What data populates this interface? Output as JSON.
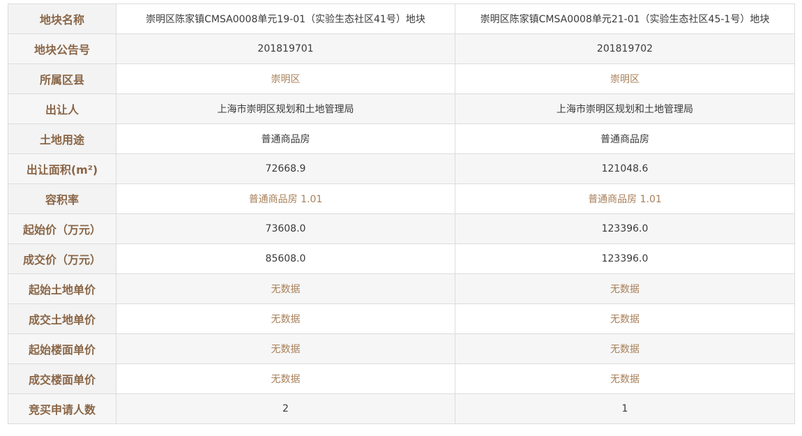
{
  "rows": [
    {
      "label": "地块名称",
      "v1": "崇明区陈家镇CMSA0008单元19-01（实验生态社区41号）地块",
      "v2": "崇明区陈家镇CMSA0008单元21-01（实验生态社区45-1号）地块",
      "style": "normal"
    },
    {
      "label": "地块公告号",
      "v1": "201819701",
      "v2": "201819702",
      "style": "normal"
    },
    {
      "label": "所属区县",
      "v1": "崇明区",
      "v2": "崇明区",
      "style": "brown"
    },
    {
      "label": "出让人",
      "v1": "上海市崇明区规划和土地管理局",
      "v2": "上海市崇明区规划和土地管理局",
      "style": "normal"
    },
    {
      "label": "土地用途",
      "v1": "普通商品房",
      "v2": "普通商品房",
      "style": "normal"
    },
    {
      "label": "出让面积(m²)",
      "v1": "72668.9",
      "v2": "121048.6",
      "style": "normal"
    },
    {
      "label": "容积率",
      "v1": "普通商品房 1.01",
      "v2": "普通商品房 1.01",
      "style": "brown"
    },
    {
      "label": "起始价（万元）",
      "v1": "73608.0",
      "v2": "123396.0",
      "style": "normal"
    },
    {
      "label": "成交价（万元）",
      "v1": "85608.0",
      "v2": "123396.0",
      "style": "normal"
    },
    {
      "label": "起始土地单价",
      "v1": "无数据",
      "v2": "无数据",
      "style": "brown"
    },
    {
      "label": "成交土地单价",
      "v1": "无数据",
      "v2": "无数据",
      "style": "brown"
    },
    {
      "label": "起始楼面单价",
      "v1": "无数据",
      "v2": "无数据",
      "style": "brown"
    },
    {
      "label": "成交楼面单价",
      "v1": "无数据",
      "v2": "无数据",
      "style": "brown"
    },
    {
      "label": "竞买申请人数",
      "v1": "2",
      "v2": "1",
      "style": "normal"
    }
  ],
  "colors": {
    "label_text": "#8a6647",
    "brown_value": "#a8805a",
    "value_text": "#3a3a3a",
    "border": "#dcdcdc"
  }
}
